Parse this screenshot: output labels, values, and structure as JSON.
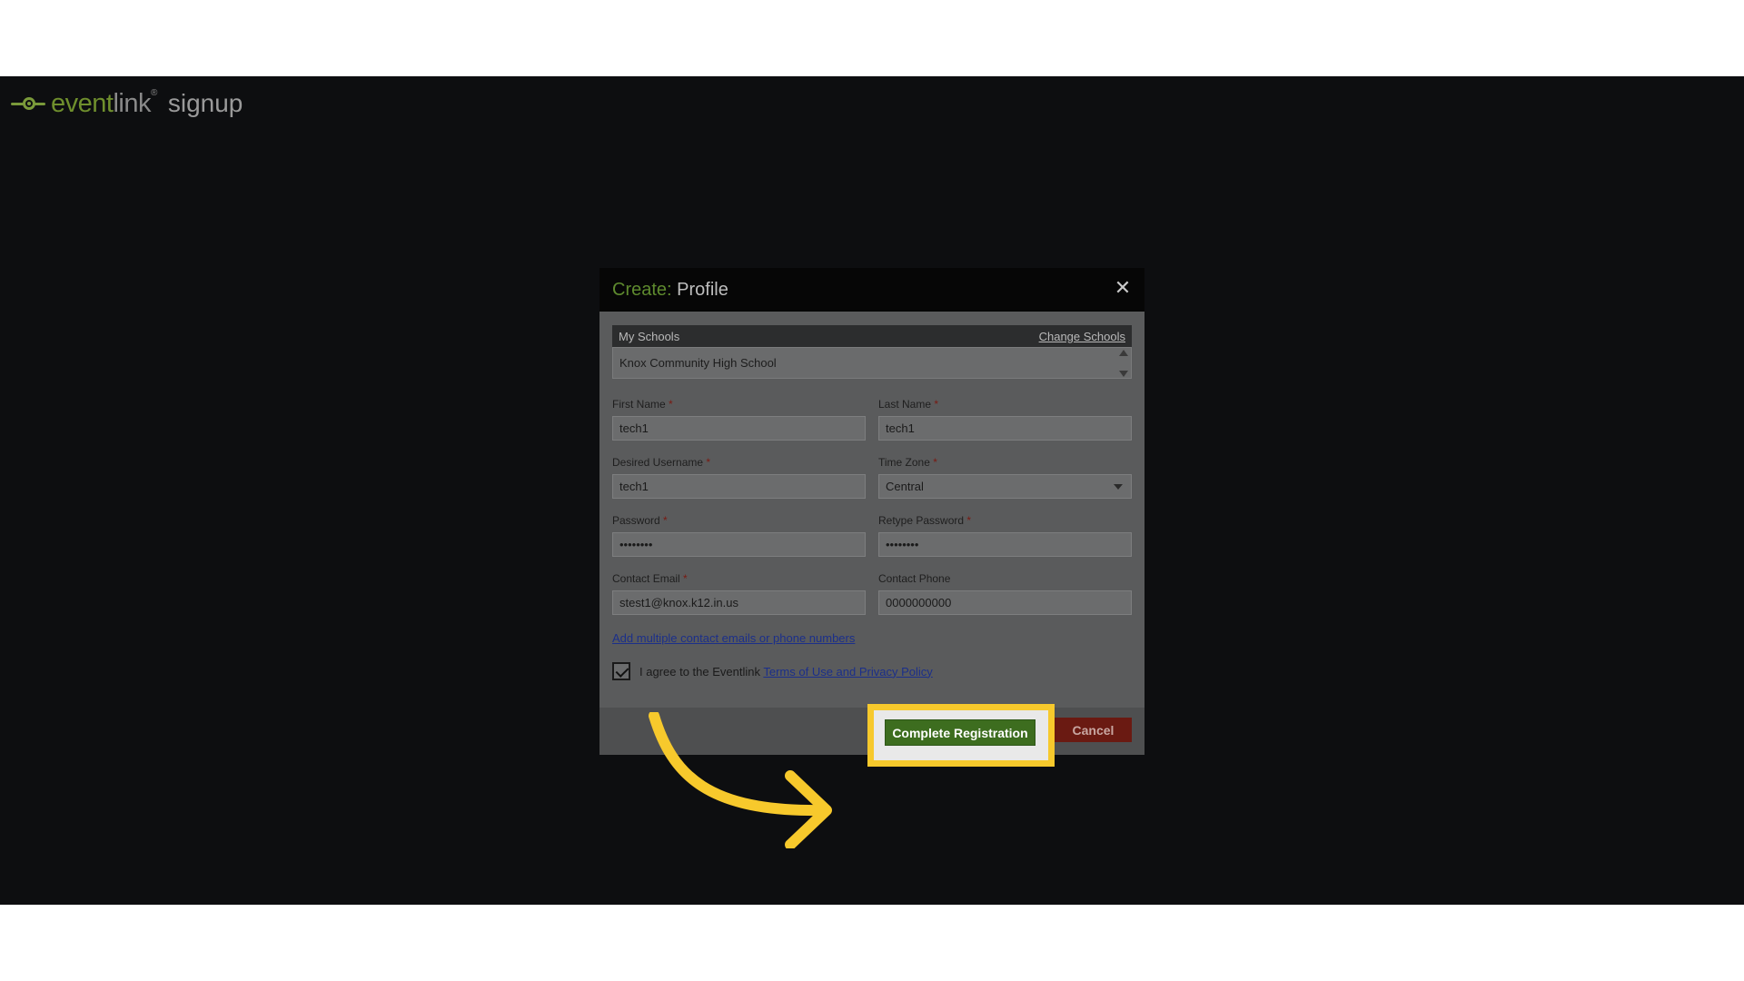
{
  "brand": {
    "word_event": "event",
    "word_link": "link",
    "trademark": "®",
    "signup": "signup"
  },
  "dialog": {
    "title_prefix": "Create:",
    "title_main": "Profile",
    "close_icon": "✕"
  },
  "schools": {
    "header_label": "My Schools",
    "change_link": "Change Schools",
    "items": [
      "Knox Community High School"
    ]
  },
  "form": {
    "required_marker": "*",
    "first_name": {
      "label": "First Name",
      "value": "tech1"
    },
    "last_name": {
      "label": "Last Name",
      "value": "tech1"
    },
    "username": {
      "label": "Desired Username",
      "value": "tech1"
    },
    "time_zone": {
      "label": "Time Zone",
      "value": "Central"
    },
    "password": {
      "label": "Password",
      "value": "••••••••"
    },
    "retype_password": {
      "label": "Retype Password",
      "value": "••••••••"
    },
    "contact_email": {
      "label": "Contact Email",
      "value": "stest1@knox.k12.in.us"
    },
    "contact_phone": {
      "label": "Contact Phone",
      "value": "0000000000"
    }
  },
  "add_contacts_link": "Add multiple contact emails or phone numbers",
  "agreement": {
    "checked": true,
    "text_before": "I agree to the Eventlink ",
    "terms_link": "Terms of Use and Privacy Policy"
  },
  "buttons": {
    "complete": "Complete Registration",
    "cancel": "Cancel"
  },
  "colors": {
    "backdrop": "#0d0e10",
    "highlight": "#f7c92c",
    "brand_green": "#6f8f2d",
    "complete_button": "#3d6d1f",
    "cancel_button": "#6a1a12"
  }
}
